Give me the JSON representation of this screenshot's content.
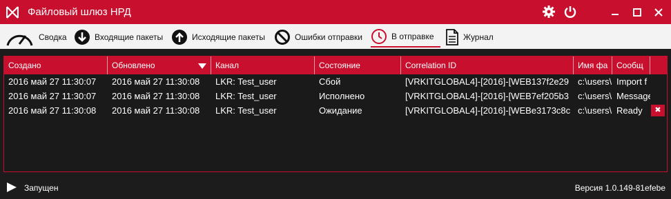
{
  "window": {
    "title": "Файловый шлюз НРД"
  },
  "toolbar": {
    "items": [
      {
        "label": "Сводка",
        "icon": "gauge-icon"
      },
      {
        "label": "Входящие пакеты",
        "icon": "arrow-down-circle-icon"
      },
      {
        "label": "Исходящие пакеты",
        "icon": "arrow-up-circle-icon"
      },
      {
        "label": "Ошибки отправки",
        "icon": "blocked-circle-icon"
      },
      {
        "label": "В отправке",
        "icon": "clock-icon",
        "active": true
      },
      {
        "label": "Журнал",
        "icon": "document-icon"
      }
    ]
  },
  "table": {
    "columns": [
      "Создано",
      "Обновлено",
      "Канал",
      "Состояние",
      "Correlation ID",
      "Имя фа",
      "Сообщ"
    ],
    "sorted_column": "Обновлено",
    "sort_direction": "descending",
    "rows": [
      [
        "2016 май 27 11:30:07",
        "2016 май 27 11:30:08",
        "LKR: Test_user",
        "Сбой",
        "[VRKITGLOBAL4]-[2016]-[WEB137f2e29",
        "c:\\users\\",
        "Import f"
      ],
      [
        "2016 май 27 11:30:07",
        "2016 май 27 11:30:08",
        "LKR: Test_user",
        "Исполнено",
        "[VRKITGLOBAL4]-[2016]-[WEB7ef205b3",
        "c:\\users\\",
        "Message"
      ],
      [
        "2016 май 27 11:30:08",
        "2016 май 27 11:30:08",
        "LKR: Test_user",
        "Ожидание",
        "[VRKITGLOBAL4]-[2016]-[WEBe3173c8c",
        "c:\\users\\",
        "Ready"
      ]
    ],
    "row_action": {
      "label": "✖",
      "icon": "delete-icon"
    }
  },
  "status": {
    "state": "Запущен",
    "version": "Версия 1.0.149-81efebe"
  },
  "colors": {
    "accent": "#c8102e",
    "background": "#1c1c1c",
    "toolbar": "#f3f3f3"
  }
}
